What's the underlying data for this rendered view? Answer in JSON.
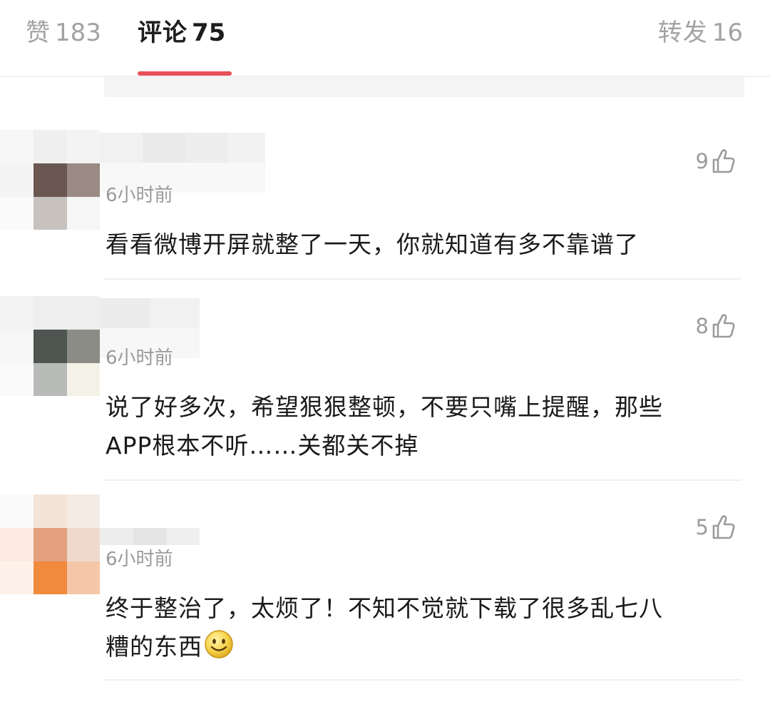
{
  "tabs": {
    "likes": {
      "label": "赞",
      "count": "183"
    },
    "comments": {
      "label": "评论",
      "count": "75"
    },
    "reposts": {
      "label": "转发",
      "count": "16"
    }
  },
  "colors": {
    "accent": "#e8505b",
    "inactive_tab": "#a3a3a3",
    "active_tab": "#1e1e1e",
    "meta_text": "#9a9a9a",
    "body_text": "#1a1a1a"
  },
  "comments": [
    {
      "time": "6小时前",
      "like_count": "9",
      "text_lines": [
        "看看微博开屏就整了一天，你就知道有多不靠谱了"
      ],
      "avatar_icon": "blurred-avatar",
      "name_hidden": true
    },
    {
      "time": "6小时前",
      "like_count": "8",
      "text_lines": [
        "说了好多次，希望狠狠整顿，不要只嘴上提醒，那些",
        "APP根本不听……关都关不掉"
      ],
      "avatar_icon": "blurred-avatar",
      "name_hidden": true
    },
    {
      "time": "6小时前",
      "like_count": "5",
      "text_lines": [
        "终于整治了，太烦了！不知不觉就下载了很多乱七八",
        "糟的东西"
      ],
      "trailing_emoji": "smile-emoji",
      "avatar_icon": "blurred-avatar",
      "name_hidden": true
    }
  ],
  "icons": {
    "like": "thumbs-up-icon",
    "emoji": "smile-emoji"
  }
}
